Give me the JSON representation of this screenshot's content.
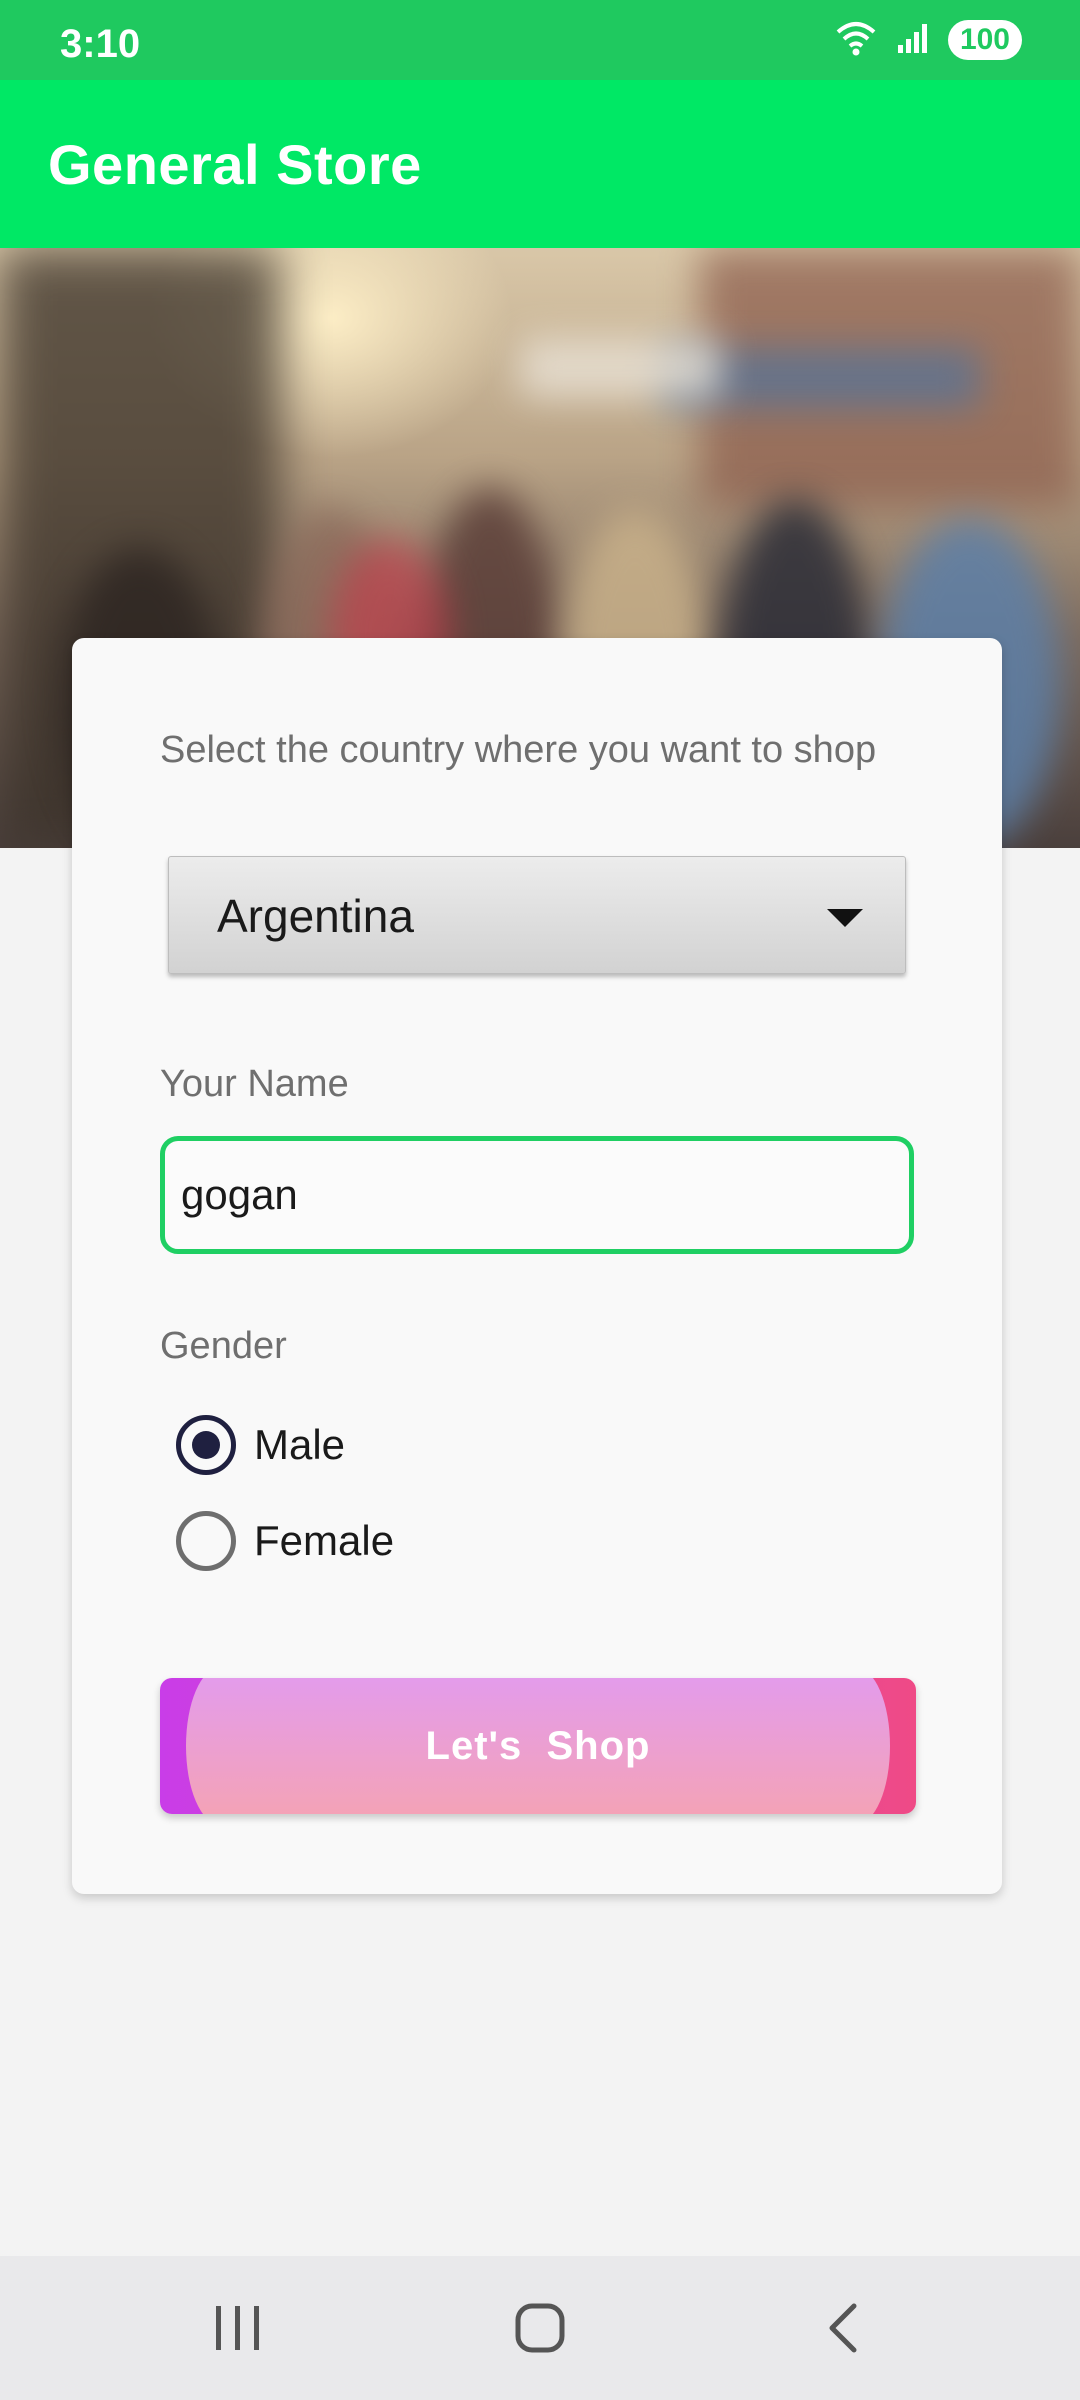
{
  "status_bar": {
    "time": "3:10",
    "battery": "100"
  },
  "app_bar": {
    "title": "General Store"
  },
  "form": {
    "country_label": "Select the country where you want to shop",
    "country_selected": "Argentina",
    "name_label": "Your Name",
    "name_value": "gogan",
    "gender_label": "Gender",
    "gender_options": [
      {
        "label": "Male",
        "checked": true
      },
      {
        "label": "Female",
        "checked": false
      }
    ],
    "submit_label": "Let's  Shop"
  },
  "colors": {
    "status_bar": "#1fc95f",
    "app_bar": "#00e865",
    "input_focus": "#1fcf63",
    "radio_checked": "#1f2040",
    "button_gradient_start": "#c93de8",
    "button_gradient_end": "#ef4a86"
  },
  "nav_bar": {
    "icons": [
      "recent-apps-icon",
      "home-icon",
      "back-icon"
    ]
  }
}
